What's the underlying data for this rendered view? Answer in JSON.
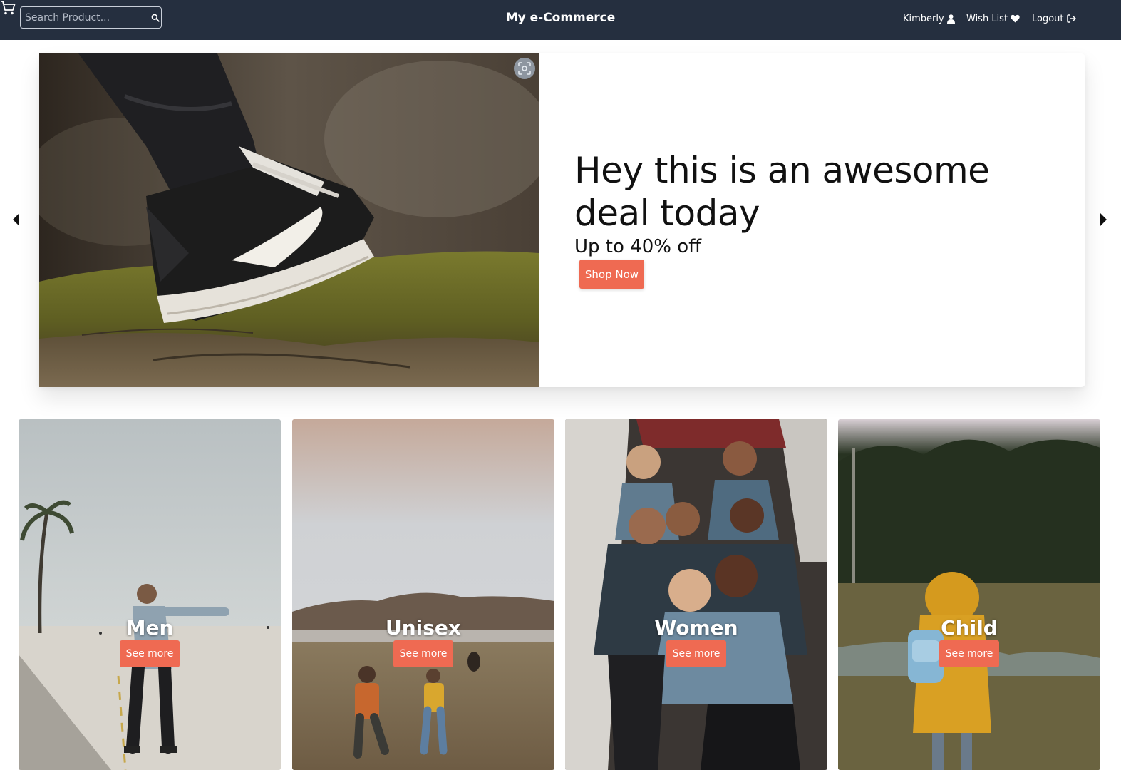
{
  "navbar": {
    "search": {
      "placeholder": "Search Product...",
      "value": "",
      "icon": "search-icon"
    },
    "brand": "My e-Commerce",
    "user": {
      "label": "Kimberly",
      "icon": "user-icon"
    },
    "wishlist": {
      "label": "Wish List",
      "icon": "heart-icon"
    },
    "logout": {
      "label": "Logout",
      "icon": "sign-out-icon"
    },
    "cart": {
      "icon": "cart-icon"
    },
    "background_color": "#252f3f"
  },
  "hero": {
    "title": "Hey this is an awesome deal today",
    "subtitle": "Up to 40% off",
    "button_label": "Shop Now",
    "image_alt": "sneaker-on-mossy-log",
    "lens_icon": "image-search-icon",
    "prev_icon": "caret-left-icon",
    "next_icon": "caret-right-icon"
  },
  "categories": [
    {
      "name": "Men",
      "button_label": "See more"
    },
    {
      "name": "Unisex",
      "button_label": "See more"
    },
    {
      "name": "Women",
      "button_label": "See more"
    },
    {
      "name": "Child",
      "button_label": "See more"
    }
  ],
  "accent_color": "#ef6a52"
}
